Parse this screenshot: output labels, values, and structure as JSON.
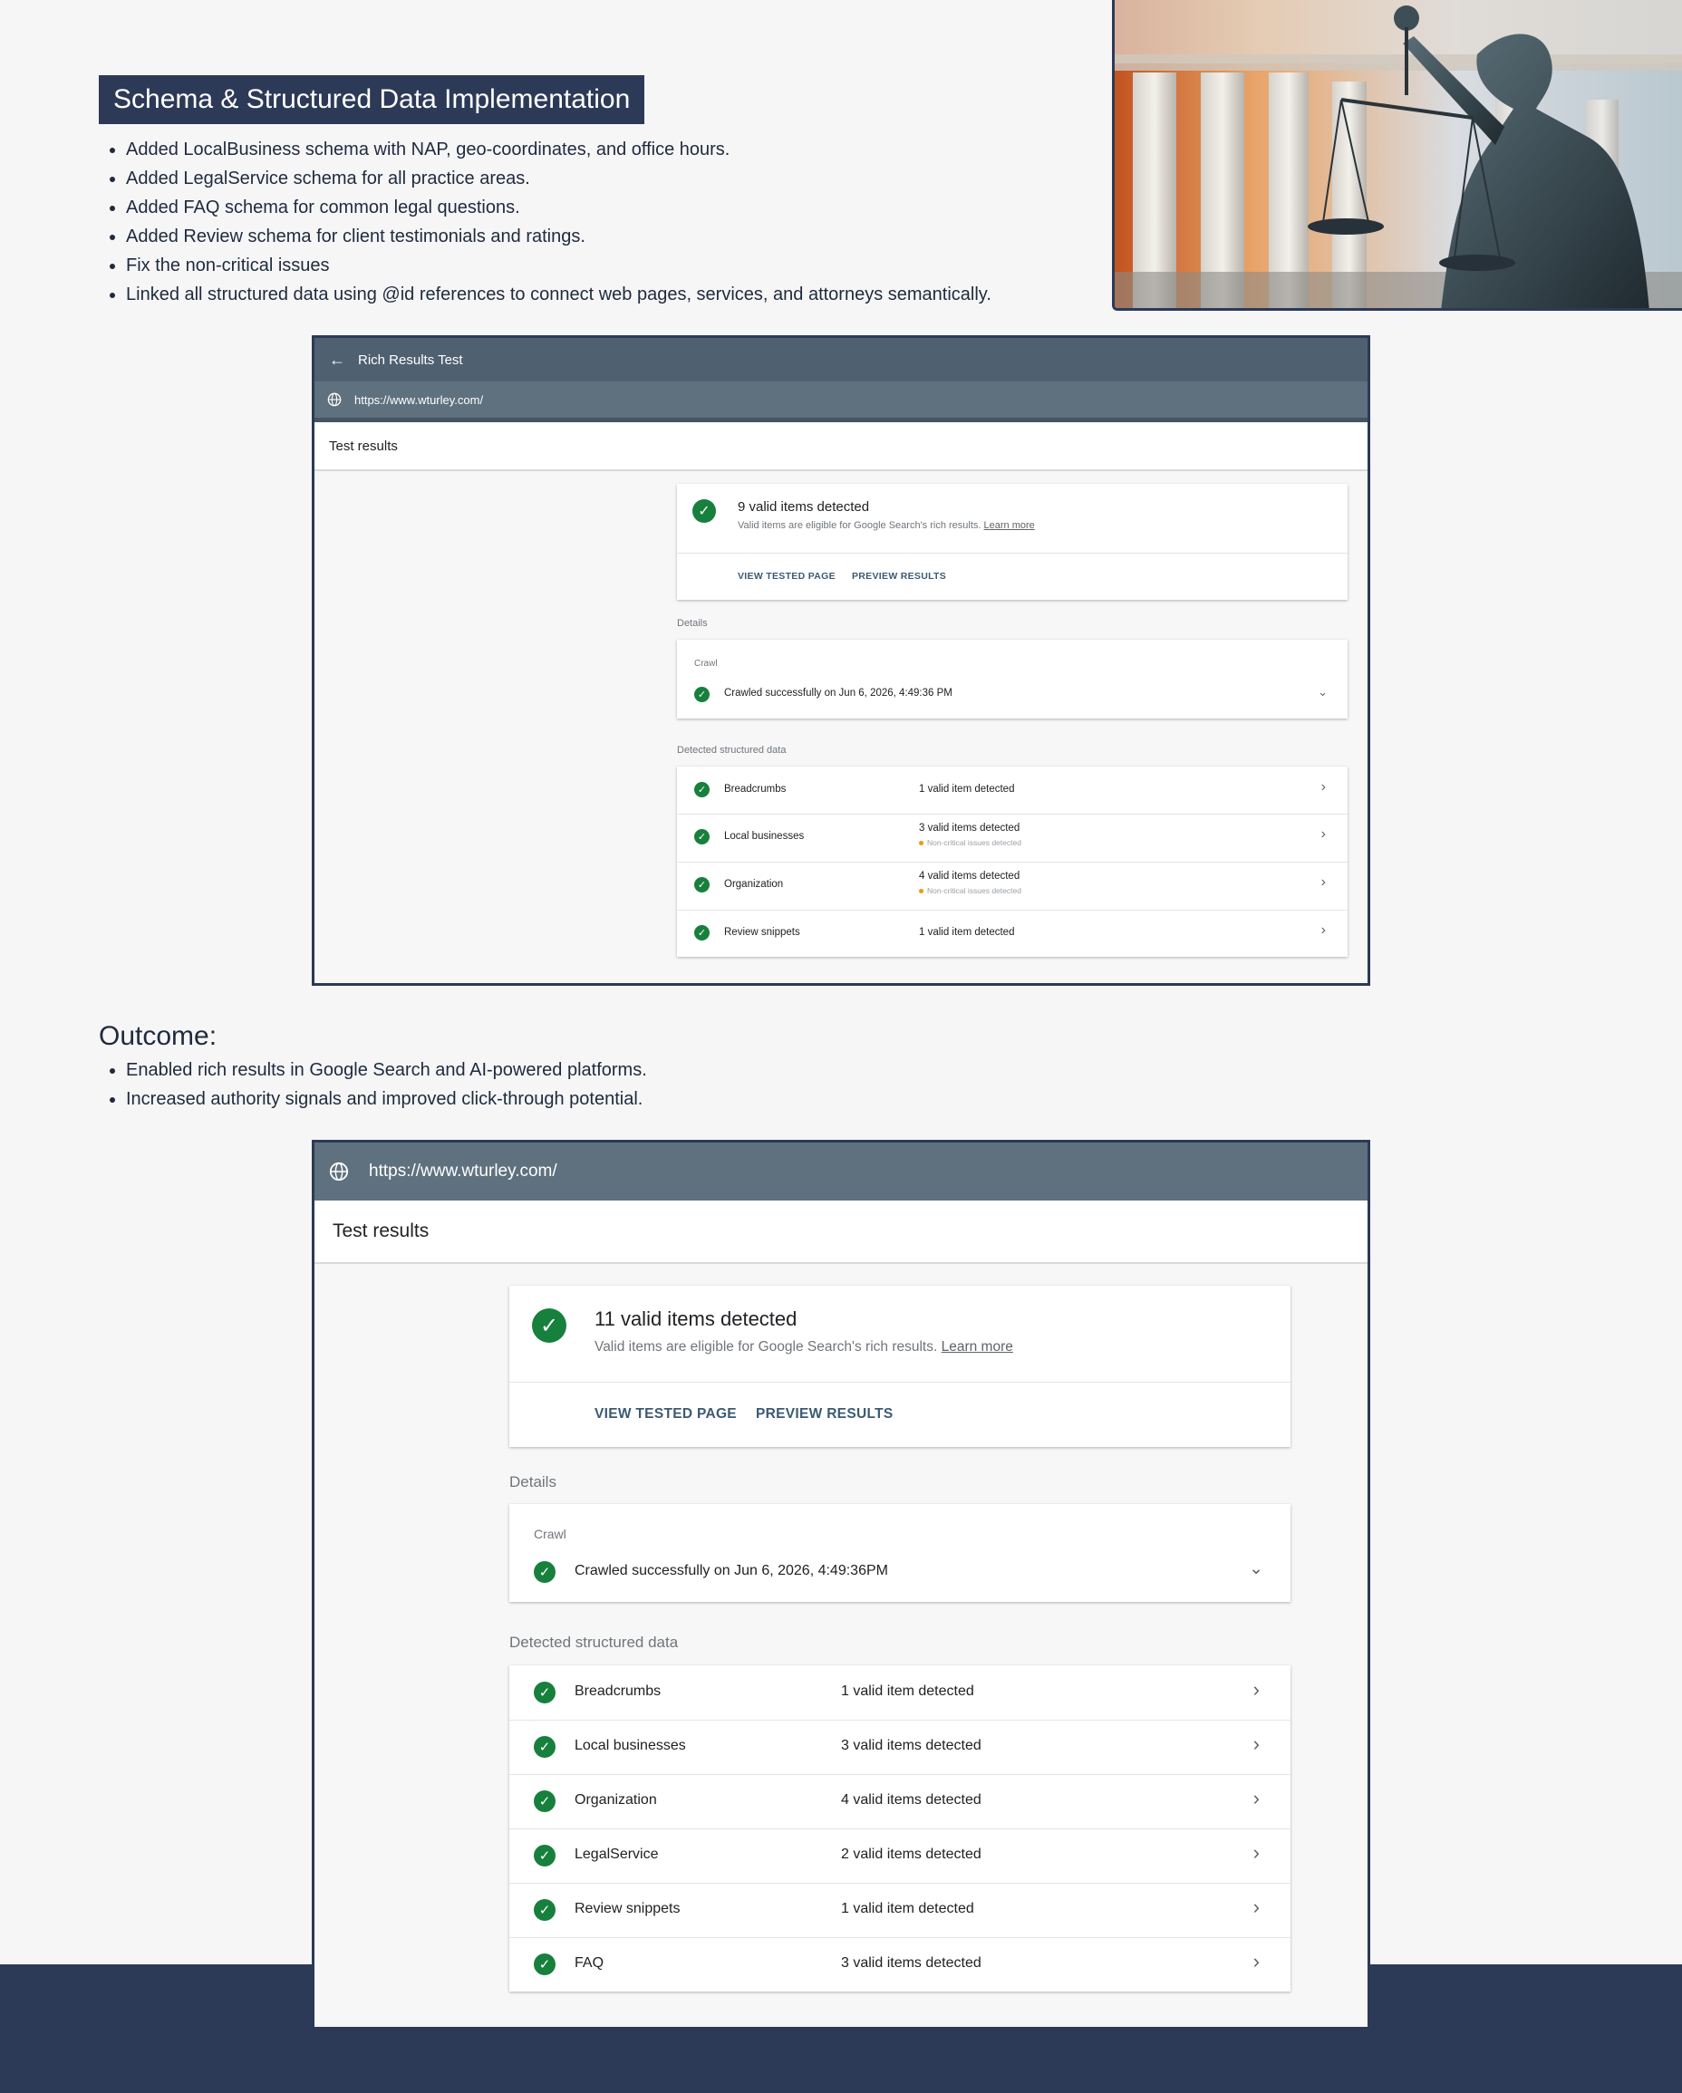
{
  "header": {
    "title": "Schema & Structured Data Implementation",
    "bullets": [
      "Added LocalBusiness schema with NAP, geo-coordinates, and office hours.",
      "Added LegalService schema for all practice areas.",
      "Added FAQ schema for common legal questions.",
      "Added Review schema for client testimonials and ratings.",
      "Fix the non-critical issues",
      "Linked all structured data using @id references to connect web pages, services, and attorneys semantically."
    ]
  },
  "outcome": {
    "title": "Outcome:",
    "bullets": [
      "Enabled rich results in Google Search and AI-powered platforms.",
      "Increased authority signals and improved click-through potential."
    ]
  },
  "colors": {
    "navy": "#2c3a57",
    "app_bar": "#4f6070",
    "success_green": "#16803c",
    "warning_orange": "#f29900"
  },
  "shot1": {
    "app_title": "Rich Results Test",
    "back_icon": "arrow-back-icon",
    "url": "https://www.wturley.com/",
    "tab": "Test results",
    "summary_title": "9 valid items detected",
    "summary_sub": "Valid items are eligible for Google Search's rich results.",
    "learn_more": "Learn more",
    "view_tested_page": "VIEW TESTED PAGE",
    "preview_results": "PREVIEW RESULTS",
    "details_label": "Details",
    "crawl_label": "Crawl",
    "crawl_status": "Crawled successfully on Jun 6, 2026, 4:49:36 PM",
    "detected_label": "Detected structured data",
    "items": [
      {
        "name": "Breadcrumbs",
        "count": "1 valid item detected",
        "note": ""
      },
      {
        "name": "Local businesses",
        "count": "3 valid items detected",
        "note": "Non-critical issues detected"
      },
      {
        "name": "Organization",
        "count": "4 valid items detected",
        "note": "Non-critical issues detected"
      },
      {
        "name": "Review snippets",
        "count": "1 valid item detected",
        "note": ""
      }
    ]
  },
  "shot2": {
    "url": "https://www.wturley.com/",
    "tab": "Test results",
    "summary_title": "11 valid items detected",
    "summary_sub": "Valid items are eligible for Google Search's rich results.",
    "learn_more": "Learn more",
    "view_tested_page": "VIEW TESTED PAGE",
    "preview_results": "PREVIEW RESULTS",
    "details_label": "Details",
    "crawl_label": "Crawl",
    "crawl_status": "Crawled successfully on Jun 6, 2026, 4:49:36PM",
    "detected_label": "Detected structured data",
    "items": [
      {
        "name": "Breadcrumbs",
        "count": "1 valid item detected"
      },
      {
        "name": "Local businesses",
        "count": "3 valid items detected"
      },
      {
        "name": "Organization",
        "count": "4 valid items detected"
      },
      {
        "name": "LegalService",
        "count": "2 valid items detected"
      },
      {
        "name": "Review snippets",
        "count": "1 valid item detected"
      },
      {
        "name": "FAQ",
        "count": "3 valid items detected"
      }
    ]
  }
}
